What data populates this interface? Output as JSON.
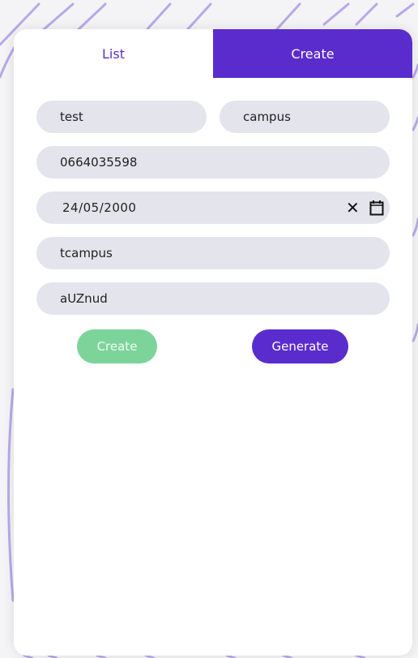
{
  "tabs": {
    "list_label": "List",
    "create_label": "Create"
  },
  "form": {
    "first_name": "test",
    "last_name": "campus",
    "phone": "0664035598",
    "birth_date": "24/05/2000",
    "username": "tcampus",
    "password": "aUZnud"
  },
  "buttons": {
    "create_label": "Create",
    "generate_label": "Generate"
  },
  "icons": {
    "clear": "close-icon",
    "calendar": "calendar-icon"
  },
  "colors": {
    "accent": "#5a2ccd",
    "create_button": "#7dd49b",
    "field_background": "#e4e4ec",
    "decorative_lines": "#b9a8e8"
  }
}
